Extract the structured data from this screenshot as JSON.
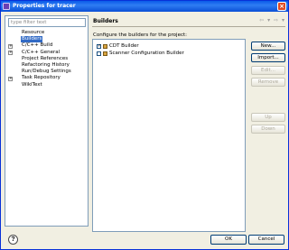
{
  "window": {
    "title": "Properties for tracer",
    "close_glyph": "×"
  },
  "filter": {
    "placeholder": "type filter text"
  },
  "tree": {
    "items": [
      {
        "label": "Resource",
        "expandable": false
      },
      {
        "label": "Builders",
        "expandable": false,
        "selected": true
      },
      {
        "label": "C/C++ Build",
        "expandable": true
      },
      {
        "label": "C/C++ General",
        "expandable": true
      },
      {
        "label": "Project References",
        "expandable": false
      },
      {
        "label": "Refactoring History",
        "expandable": false
      },
      {
        "label": "Run/Debug Settings",
        "expandable": false
      },
      {
        "label": "Task Repository",
        "expandable": true
      },
      {
        "label": "WikiText",
        "expandable": false
      }
    ],
    "expand_glyph": "+"
  },
  "page": {
    "title": "Builders",
    "description": "Configure the builders for the project:"
  },
  "builders": [
    {
      "label": "CDT Builder",
      "checked": true
    },
    {
      "label": "Scanner Configuration Builder",
      "checked": false
    }
  ],
  "side_buttons": {
    "new": "New...",
    "import": "Import...",
    "edit": "Edit...",
    "remove": "Remove",
    "up": "Up",
    "down": "Down"
  },
  "footer": {
    "help": "?",
    "ok": "OK",
    "cancel": "Cancel"
  },
  "colors": {
    "accent": "#316ac5",
    "title_bar": "#0a5ae8",
    "dialog_bg": "#f1efe2"
  },
  "icons": {
    "nav_back": "⇦",
    "nav_back_menu": "▾",
    "nav_forward": "⇨",
    "nav_forward_menu": "▾",
    "check": "✓"
  }
}
